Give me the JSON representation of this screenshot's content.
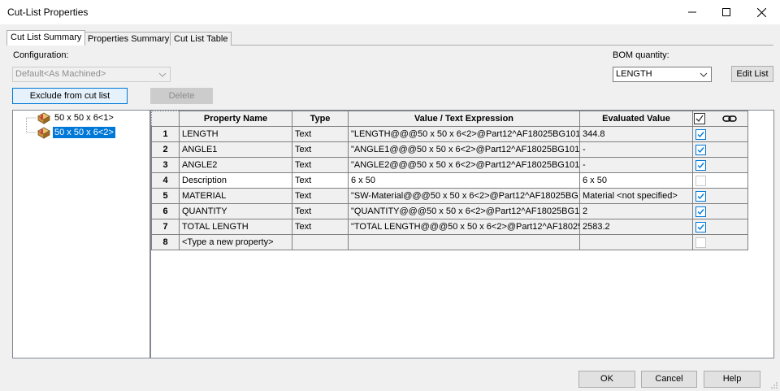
{
  "window": {
    "title": "Cut-List Properties",
    "controls": {
      "minimize": "—",
      "maximize": "☐",
      "close": "✕"
    }
  },
  "tabs": [
    {
      "label": "Cut List Summary",
      "active": true
    },
    {
      "label": "Properties Summary",
      "active": false
    },
    {
      "label": "Cut List Table",
      "active": false
    }
  ],
  "configuration": {
    "label": "Configuration:",
    "value": "Default<As Machined>"
  },
  "bom": {
    "label": "BOM quantity:",
    "value": "LENGTH"
  },
  "buttons": {
    "edit_list": "Edit List",
    "exclude": "Exclude from cut list",
    "delete": "Delete",
    "ok": "OK",
    "cancel": "Cancel",
    "help": "Help"
  },
  "tree": {
    "items": [
      {
        "label": "50 x 50 x 6<1>",
        "selected": false,
        "icon": "cut-list-item-icon"
      },
      {
        "label": "50 x 50 x 6<2>",
        "selected": true,
        "icon": "cut-list-item-icon"
      }
    ]
  },
  "grid": {
    "headers": {
      "num": "",
      "property_name": "Property Name",
      "type": "Type",
      "value": "Value / Text Expression",
      "evaluated": "Evaluated Value",
      "check_icon": "checkbox-header-icon",
      "link_icon": "link-icon"
    },
    "rows": [
      {
        "num": "1",
        "name": "LENGTH",
        "type": "Text",
        "value": "\"LENGTH@@@50 x 50 x 6<2>@Part12^AF18025BG101.",
        "evaluated": "344.8",
        "checked": true,
        "gray": true
      },
      {
        "num": "2",
        "name": "ANGLE1",
        "type": "Text",
        "value": "\"ANGLE1@@@50 x 50 x 6<2>@Part12^AF18025BG101.",
        "evaluated": "-",
        "checked": true,
        "gray": true
      },
      {
        "num": "3",
        "name": "ANGLE2",
        "type": "Text",
        "value": "\"ANGLE2@@@50 x 50 x 6<2>@Part12^AF18025BG101.",
        "evaluated": "-",
        "checked": true,
        "gray": true
      },
      {
        "num": "4",
        "name": "Description",
        "type": "Text",
        "value": "6 x 50",
        "evaluated": "6 x 50",
        "checked": false,
        "gray": false
      },
      {
        "num": "5",
        "name": "MATERIAL",
        "type": "Text",
        "value": "\"SW-Material@@@50 x 50 x 6<2>@Part12^AF18025BG",
        "evaluated": "Material <not specified>",
        "checked": true,
        "gray": true
      },
      {
        "num": "6",
        "name": "QUANTITY",
        "type": "Text",
        "value": "\"QUANTITY@@@50 x 50 x 6<2>@Part12^AF18025BG10",
        "evaluated": "2",
        "checked": true,
        "gray": true
      },
      {
        "num": "7",
        "name": "TOTAL LENGTH",
        "type": "Text",
        "value": "\"TOTAL LENGTH@@@50 x 50 x 6<2>@Part12^AF18025",
        "evaluated": "2583.2",
        "checked": true,
        "gray": true
      },
      {
        "num": "8",
        "name": "<Type a new property>",
        "type": "",
        "value": "",
        "evaluated": "",
        "checked": false,
        "gray": true
      }
    ]
  },
  "colors": {
    "accent": "#0078d7",
    "selection": "#0078d7",
    "grid_line": "#808080",
    "header_bg": "#f0f0f0"
  }
}
